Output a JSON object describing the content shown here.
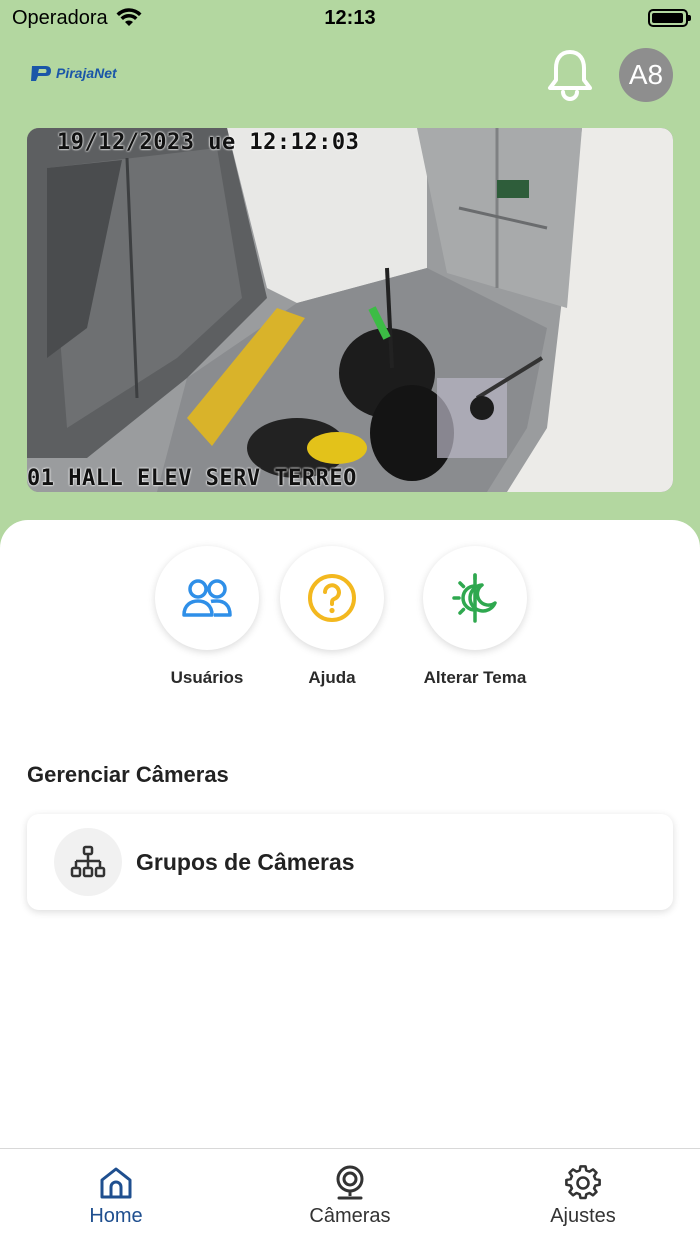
{
  "status_bar": {
    "carrier": "Operadora",
    "time": "12:13"
  },
  "header": {
    "logo_text": "PirajaNet",
    "avatar_initials": "A8"
  },
  "camera": {
    "timestamp": "19/12/2023 ue 12:12:03",
    "name": "01 HALL ELEV SERV TERREO"
  },
  "actions": [
    {
      "label": "Usuários",
      "icon": "users-icon",
      "color": "#2f8fe8"
    },
    {
      "label": "Ajuda",
      "icon": "help-icon",
      "color": "#f3b81f"
    },
    {
      "label": "Alterar Tema",
      "icon": "theme-toggle-icon",
      "color": "#2fa84f"
    }
  ],
  "manage": {
    "title": "Gerenciar Câmeras",
    "groups_label": "Grupos de Câmeras"
  },
  "tabs": [
    {
      "label": "Home",
      "icon": "home-icon",
      "active": true
    },
    {
      "label": "Câmeras",
      "icon": "camera-icon",
      "active": false
    },
    {
      "label": "Ajustes",
      "icon": "settings-icon",
      "active": false
    }
  ],
  "colors": {
    "background": "#b3d7a0",
    "tab_active": "#1f4f8f",
    "logo": "#1a56a8"
  }
}
